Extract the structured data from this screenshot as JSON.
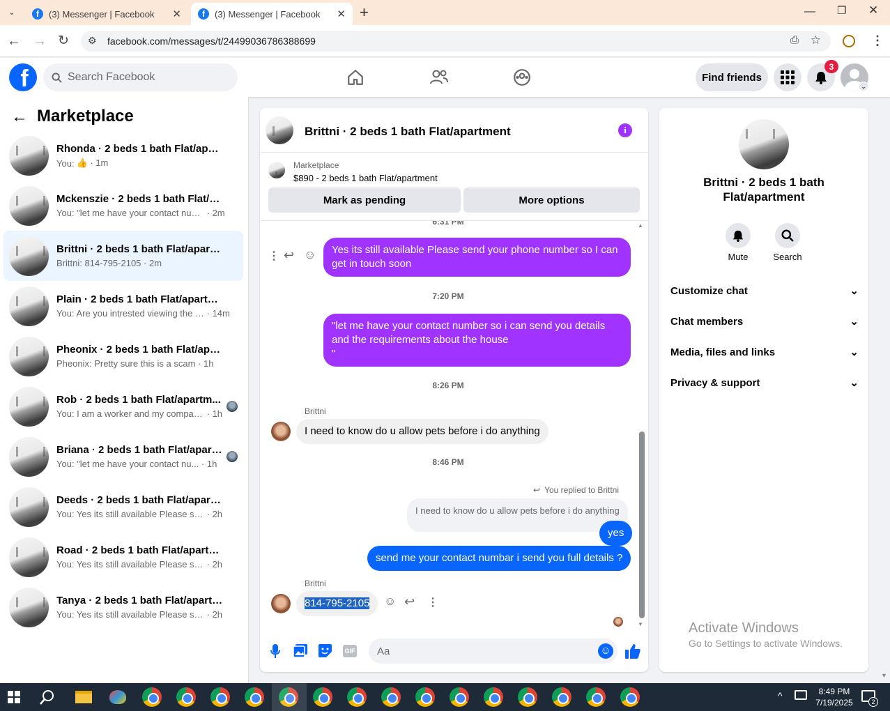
{
  "browser": {
    "tabs": [
      {
        "title": "(3) Messenger | Facebook",
        "active": false
      },
      {
        "title": "(3) Messenger | Facebook",
        "active": true
      }
    ],
    "url": "facebook.com/messages/t/24499036786388699"
  },
  "fb_header": {
    "logo": "f",
    "search_placeholder": "Search Facebook",
    "find_friends": "Find friends",
    "notification_count": "3"
  },
  "sidebar": {
    "title": "Marketplace",
    "conversations": [
      {
        "title": "Rhonda · 2 beds 1 bath Flat/apart...",
        "preview": "You:",
        "time": "1m",
        "like": true
      },
      {
        "title": "Mckenszie · 2 beds 1 bath Flat/apa...",
        "preview": "You: \"let me have your contact numb...",
        "time": "2m"
      },
      {
        "title": "Brittni · 2 beds 1 bath Flat/apartm...",
        "preview": "Brittni: 814-795-2105",
        "time": "2m",
        "selected": true
      },
      {
        "title": "Plain · 2 beds 1 bath Flat/apartment",
        "preview": "You: Are you intrested viewing the h...",
        "time": "14m"
      },
      {
        "title": "Pheonix · 2 beds 1 bath Flat/apart...",
        "preview": "Pheonix: Pretty sure this is a scam",
        "time": "1h"
      },
      {
        "title": "Rob · 2 beds 1 bath Flat/apartm...",
        "preview": "You: I am a worker and my compan...",
        "time": "1h",
        "avatar": true
      },
      {
        "title": "Briana · 2 beds 1 bath Flat/apart...",
        "preview": "You: \"let me have your contact nu...",
        "time": "1h",
        "avatar": true
      },
      {
        "title": "Deeds · 2 beds 1 bath Flat/apartm...",
        "preview": "You: Yes its still available Please send ...",
        "time": "2h"
      },
      {
        "title": "Road · 2 beds 1 bath Flat/apartment",
        "preview": "You: Yes its still available Please send ...",
        "time": "2h"
      },
      {
        "title": "Tanya · 2 beds 1 bath Flat/apartment",
        "preview": "You: Yes its still available Please send ...",
        "time": "2h"
      }
    ]
  },
  "chat": {
    "header_title": "Brittni · 2 beds 1 bath Flat/apartment",
    "listing_label": "Marketplace",
    "listing_desc": "$890 - 2 beds 1 bath Flat/apartment",
    "mark_pending": "Mark as pending",
    "more_options": "More options",
    "partial_time": "6:31 PM",
    "msg1": "Yes its still available Please send your phone number so I can get in touch soon",
    "time2": "7:20 PM",
    "msg2_l1": "\"let me have your contact number so i can send you details",
    "msg2_l2": "and the requirements about the house",
    "msg2_l3": "\"",
    "time3": "8:26 PM",
    "sender_name": "Brittni",
    "msg3": "I need to know do u allow pets before i do anything",
    "time4": "8:46 PM",
    "replied_label": "You replied to Brittni",
    "quoted": "I need to know do u allow pets before i do anything",
    "msg4": "yes",
    "msg5": "send me your contact numbar i send you full details ?",
    "sender_name2": "Brittni",
    "msg6": "814-795-2105",
    "composer_placeholder": "Aa"
  },
  "details": {
    "name": "Brittni · 2 beds 1 bath Flat/apartment",
    "mute": "Mute",
    "search": "Search",
    "sections": [
      "Customize chat",
      "Chat members",
      "Media, files and links",
      "Privacy & support"
    ]
  },
  "watermark": {
    "title": "Activate Windows",
    "sub": "Go to Settings to activate Windows."
  },
  "taskbar": {
    "time": "8:49 PM",
    "date": "7/19/2025",
    "notif_count": "2"
  },
  "colors": {
    "accent_purple": "#a033ff",
    "accent_blue": "#0866ff",
    "fb_blue": "#1877f2",
    "badge_red": "#e41e3f"
  }
}
